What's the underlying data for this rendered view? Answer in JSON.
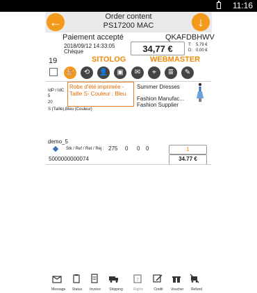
{
  "status": {
    "time": "11:16"
  },
  "header": {
    "title": "Order content",
    "subtitle": "PS17200 MAC",
    "back_icon": "arrow-left-icon",
    "download_icon": "arrow-down-icon"
  },
  "summary": {
    "payment_status": "Paiement accepté",
    "order_ref": "QKAFDBHWV",
    "datetime": "2018/09/12 14:33:05",
    "payment_method": "Chèque",
    "total": "34,77 €",
    "tax_label": "T:",
    "tax_value": "5,79 €",
    "discount_label": "D:",
    "discount_value": "0,00 €"
  },
  "sources": {
    "left": "SITOLOG",
    "right": "WEBMASTER"
  },
  "toolbar": {
    "count": "19"
  },
  "product": {
    "id_labels": "IdP / IdC",
    "id_line1": "5",
    "id_line2": "20",
    "attributes": "S (Taille),Bleu (Couleur)",
    "tooltip_text": "Robe d'été imprimée - Taille S- Couleur : Bleu",
    "name": "Summer Dresses",
    "manufacturer": "Fashion Manufac...",
    "supplier": "Fashion Supplier"
  },
  "line_item": {
    "customer": "demo_5",
    "qty_labels": "Stk / Ref / Ret / Rej :",
    "qty_stock": "275",
    "qty_ref": "0",
    "qty_ret": "0",
    "qty_rej": "0",
    "quantity": "1",
    "ean": "5000000000074",
    "line_total": "34.77 €"
  },
  "bottom_bar": {
    "items": [
      {
        "label": "Message"
      },
      {
        "label": "Status"
      },
      {
        "label": "Invoice"
      },
      {
        "label": "Shipping"
      },
      {
        "label": "Rights"
      },
      {
        "label": "Credit"
      },
      {
        "label": "Voucher"
      },
      {
        "label": "Refund"
      }
    ]
  },
  "colors": {
    "accent": "#f39a1d",
    "header_bg": "#e9e9e9"
  }
}
